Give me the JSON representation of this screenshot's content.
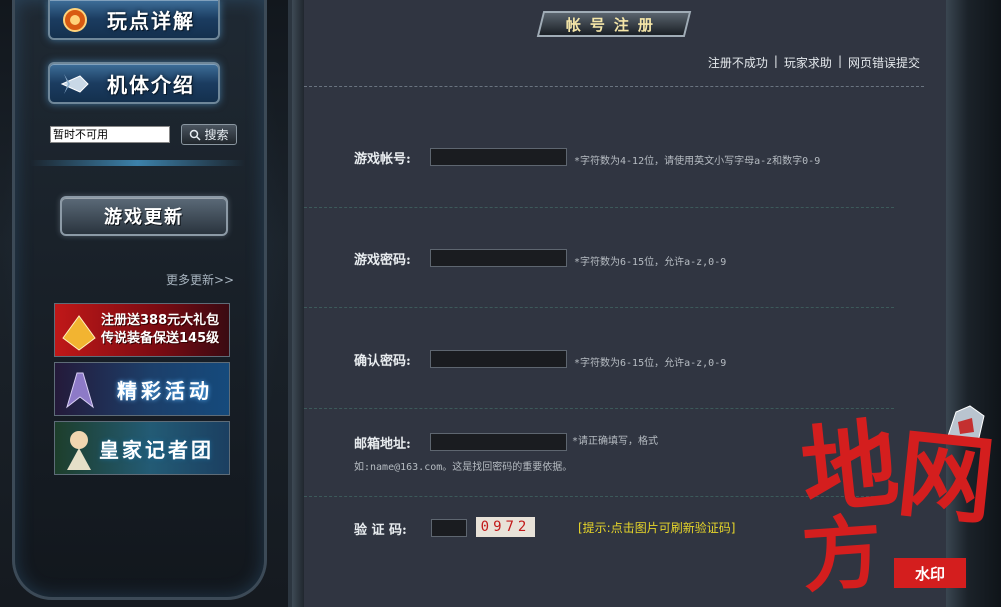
{
  "sidebar": {
    "nav_gameplay_label": "玩点详解",
    "nav_mecha_label": "机体介绍",
    "search_value": "暂时不可用",
    "search_button_label": "搜索",
    "update_header": "游戏更新",
    "more_updates": "更多更新>>",
    "banners": [
      {
        "text_line1": "注册送388元大礼包",
        "text_line2": "传说装备保送145级"
      },
      {
        "text": "精彩活动"
      },
      {
        "text": "皇家记者团"
      }
    ]
  },
  "page": {
    "title": "帐号注册",
    "help_links": [
      "注册不成功",
      "玩家求助",
      "网页错误提交"
    ]
  },
  "form": {
    "account": {
      "label": "游戏帐号:",
      "value": "",
      "hint": "*字符数为4-12位，请使用英文小写字母a-z和数字0-9"
    },
    "password": {
      "label": "游戏密码:",
      "value": "",
      "hint": "*字符数为6-15位，允许a-z,0-9"
    },
    "confirm_password": {
      "label": "确认密码:",
      "value": "",
      "hint": "*字符数为6-15位，允许a-z,0-9"
    },
    "email": {
      "label": "邮箱地址:",
      "value": "",
      "hint": "*请正确填写，格式如:name@163.com。这是找回密码的重要依据。"
    },
    "captcha": {
      "label": "验 证 码:",
      "value": "",
      "image_text": "0972",
      "tip": "[提示:点击图片可刷新验证码]"
    }
  },
  "watermark": {
    "chars": [
      "地",
      "网",
      "方"
    ],
    "stamp": "水印"
  },
  "colors": {
    "content_bg": "#303541",
    "captcha_tip": "#e7d62a",
    "watermark_red": "#d41e1e"
  }
}
